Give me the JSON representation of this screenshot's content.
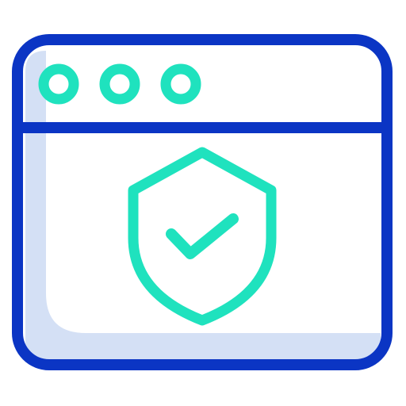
{
  "icon": {
    "name": "secure-browser-icon",
    "colors": {
      "outline": "#0B35C4",
      "accent": "#1FE2BE",
      "fill": "#D4E0F5",
      "background": "#FFFFFF"
    },
    "window_dots": 3
  }
}
